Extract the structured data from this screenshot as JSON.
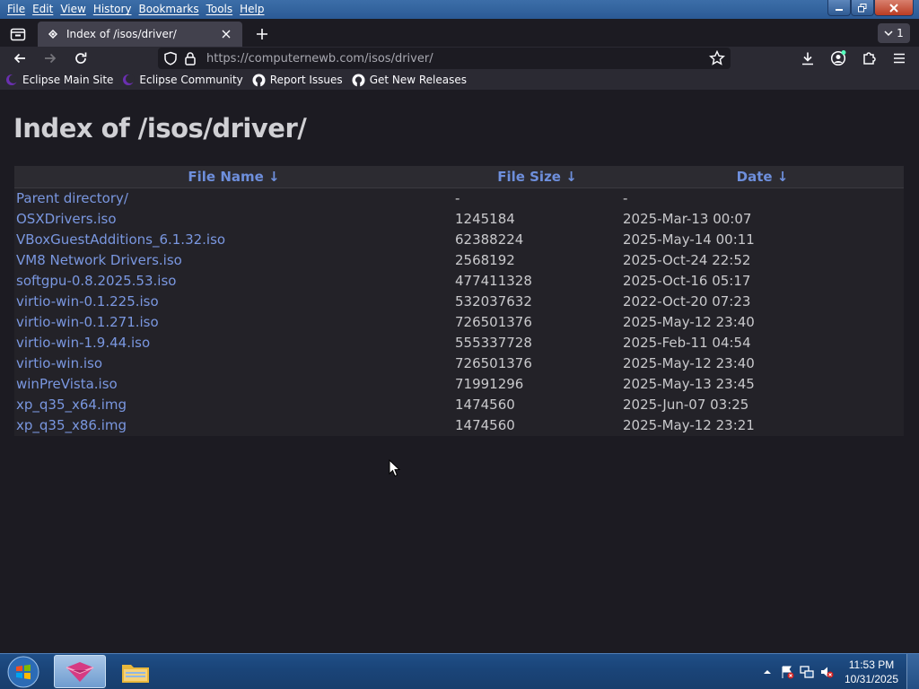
{
  "menu": [
    "File",
    "Edit",
    "View",
    "History",
    "Bookmarks",
    "Tools",
    "Help"
  ],
  "tab": {
    "title": "Index of /isos/driver/"
  },
  "tab_list_count": "1",
  "url": {
    "host": "https://computernewb.com",
    "path": "/isos/driver/"
  },
  "bookmarks": [
    "Eclipse Main Site",
    "Eclipse Community",
    "Report Issues",
    "Get New Releases"
  ],
  "page": {
    "title": "Index of /isos/driver/",
    "columns": [
      "File Name  ↓",
      "File Size  ↓",
      "Date  ↓"
    ],
    "rows": [
      {
        "name": "Parent directory/",
        "size": "-",
        "date": "-"
      },
      {
        "name": "OSXDrivers.iso",
        "size": "1245184",
        "date": "2025-Mar-13 00:07"
      },
      {
        "name": "VBoxGuestAdditions_6.1.32.iso",
        "size": "62388224",
        "date": "2025-May-14 00:11"
      },
      {
        "name": "VM8 Network Drivers.iso",
        "size": "2568192",
        "date": "2025-Oct-24 22:52"
      },
      {
        "name": "softgpu-0.8.2025.53.iso",
        "size": "477411328",
        "date": "2025-Oct-16 05:17"
      },
      {
        "name": "virtio-win-0.1.225.iso",
        "size": "532037632",
        "date": "2022-Oct-20 07:23"
      },
      {
        "name": "virtio-win-0.1.271.iso",
        "size": "726501376",
        "date": "2025-May-12 23:40"
      },
      {
        "name": "virtio-win-1.9.44.iso",
        "size": "555337728",
        "date": "2025-Feb-11 04:54"
      },
      {
        "name": "virtio-win.iso",
        "size": "726501376",
        "date": "2025-May-12 23:40"
      },
      {
        "name": "winPreVista.iso",
        "size": "71991296",
        "date": "2025-May-13 23:45"
      },
      {
        "name": "xp_q35_x64.img",
        "size": "1474560",
        "date": "2025-Jun-07 03:25"
      },
      {
        "name": "xp_q35_x86.img",
        "size": "1474560",
        "date": "2025-May-12 23:21"
      }
    ]
  },
  "clock": {
    "time": "11:53 PM",
    "date": "10/31/2025"
  },
  "colors": {
    "link": "#7a97e0",
    "header": "#6e8fdc",
    "background": "#1c1b22"
  }
}
